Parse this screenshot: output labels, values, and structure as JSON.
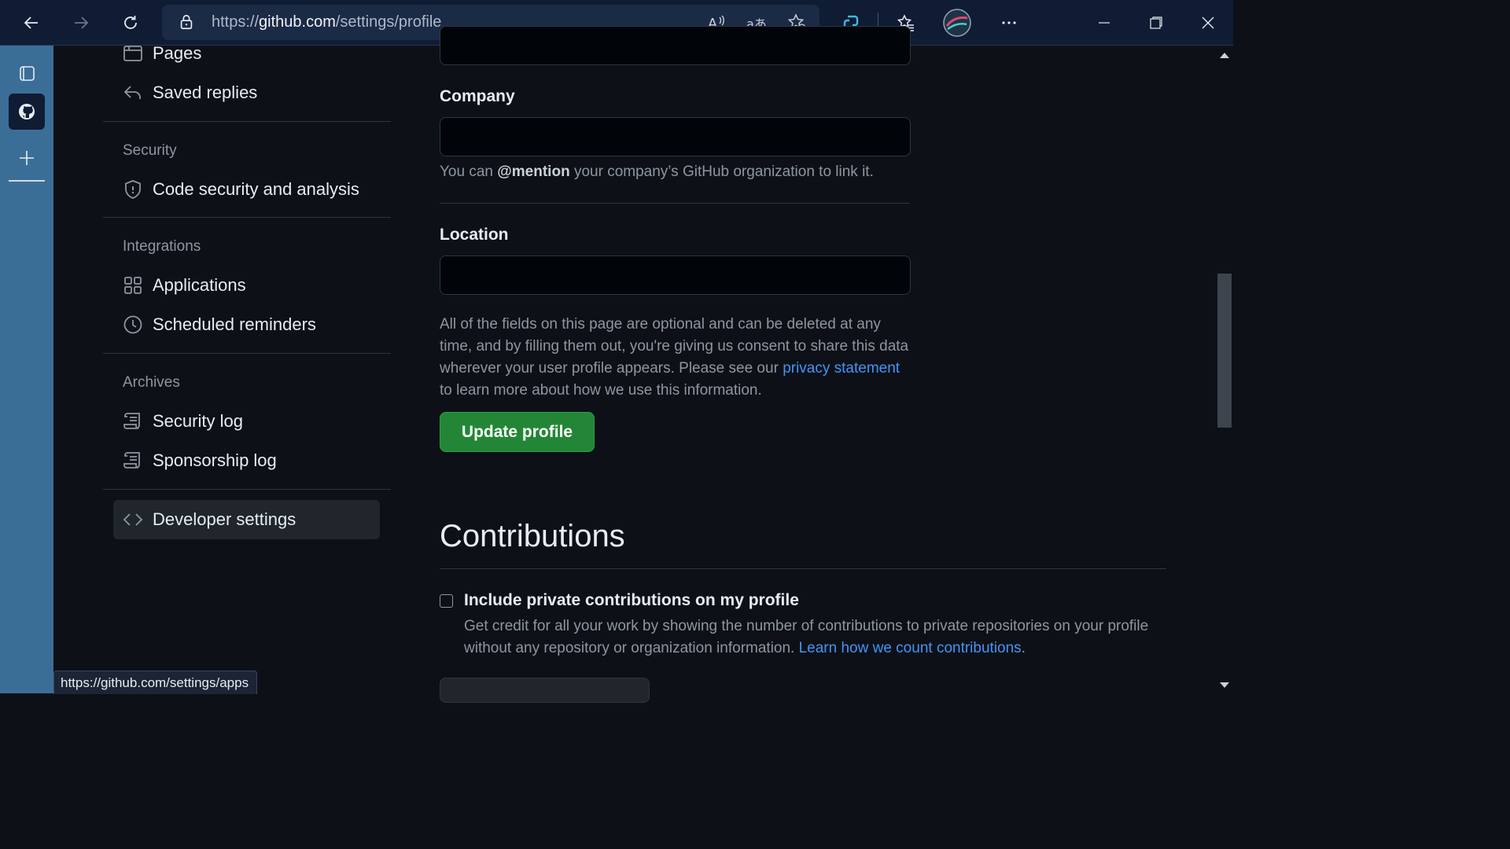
{
  "browser": {
    "url_prefix": "https://",
    "url_domain": "github.com",
    "url_path": "/settings/profile",
    "status_url": "https://github.com/settings/apps"
  },
  "nav": {
    "items_top": [
      {
        "label": "Pages",
        "icon": "browser-icon"
      },
      {
        "label": "Saved replies",
        "icon": "reply-icon"
      }
    ],
    "security_heading": "Security",
    "security_items": [
      {
        "label": "Code security and analysis",
        "icon": "shield-icon"
      }
    ],
    "integrations_heading": "Integrations",
    "integrations_items": [
      {
        "label": "Applications",
        "icon": "apps-grid-icon"
      },
      {
        "label": "Scheduled reminders",
        "icon": "clock-icon"
      }
    ],
    "archives_heading": "Archives",
    "archives_items": [
      {
        "label": "Security log",
        "icon": "log-icon"
      },
      {
        "label": "Sponsorship log",
        "icon": "log-icon"
      }
    ],
    "developer_settings": "Developer settings"
  },
  "form": {
    "company_label": "Company",
    "company_value": "",
    "company_note_pre": "You can ",
    "company_note_mention": "@mention",
    "company_note_post": " your company’s GitHub organization to link it.",
    "location_label": "Location",
    "location_value": "",
    "optional_note_1": "All of the fields on this page are optional and can be deleted at any time, and by filling them out, you're giving us consent to share this data wherever your user profile appears. Please see our ",
    "privacy_link": "privacy statement",
    "optional_note_2": " to learn more about how we use this information.",
    "update_button": "Update profile"
  },
  "contributions": {
    "heading": "Contributions",
    "checkbox_label": "Include private contributions on my profile",
    "checkbox_checked": false,
    "note_pre": "Get credit for all your work by showing the number of contributions to private repositories on your profile without any repository or organization information. ",
    "note_link": "Learn how we count contributions",
    "note_post": "."
  },
  "colors": {
    "accent_green": "#238636",
    "link_blue": "#4493f8",
    "browser_sidebar": "#3b6e97"
  }
}
